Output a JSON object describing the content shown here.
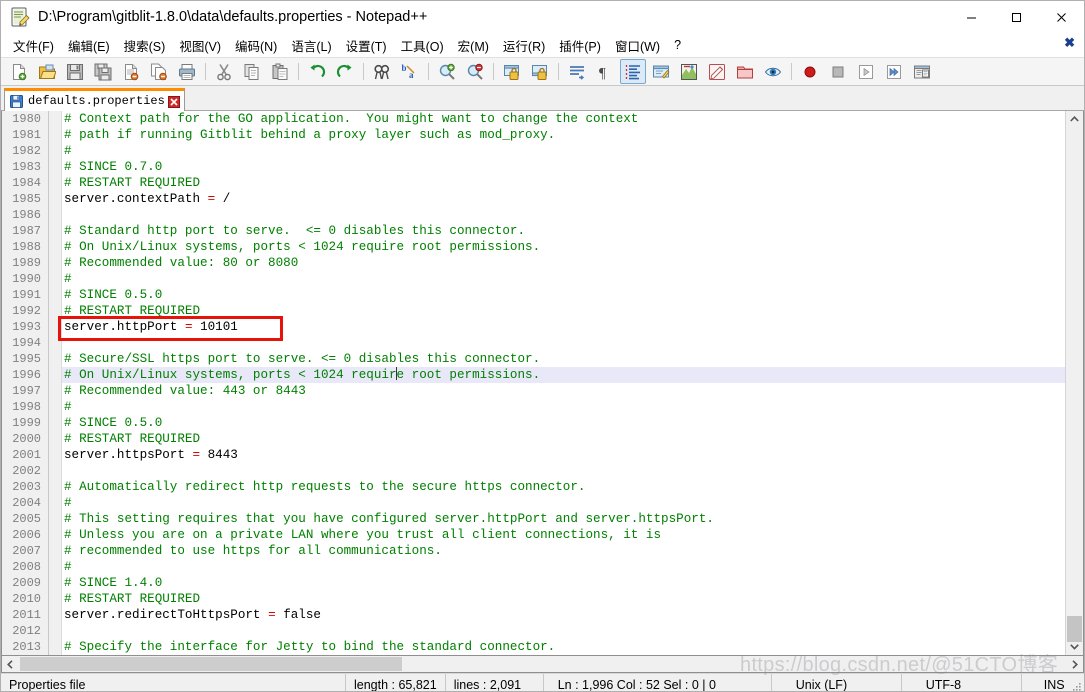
{
  "window": {
    "title": "D:\\Program\\gitblit-1.8.0\\data\\defaults.properties - Notepad++",
    "icon": "notepad-plus-plus-icon",
    "minimize": "—",
    "maximize": "☐",
    "close": "✕"
  },
  "menubar": {
    "items": [
      {
        "label": "文件(F)",
        "name": "menu-file"
      },
      {
        "label": "编辑(E)",
        "name": "menu-edit"
      },
      {
        "label": "搜索(S)",
        "name": "menu-search"
      },
      {
        "label": "视图(V)",
        "name": "menu-view"
      },
      {
        "label": "编码(N)",
        "name": "menu-encoding"
      },
      {
        "label": "语言(L)",
        "name": "menu-language"
      },
      {
        "label": "设置(T)",
        "name": "menu-settings"
      },
      {
        "label": "工具(O)",
        "name": "menu-tools"
      },
      {
        "label": "宏(M)",
        "name": "menu-macro"
      },
      {
        "label": "运行(R)",
        "name": "menu-run"
      },
      {
        "label": "插件(P)",
        "name": "menu-plugins"
      },
      {
        "label": "窗口(W)",
        "name": "menu-window"
      },
      {
        "label": "?",
        "name": "menu-help"
      }
    ],
    "close_doc": "✖"
  },
  "toolbar": {
    "buttons": [
      {
        "name": "new-file-icon",
        "title": "New"
      },
      {
        "name": "open-file-icon",
        "title": "Open"
      },
      {
        "name": "save-icon",
        "title": "Save"
      },
      {
        "name": "save-all-icon",
        "title": "Save All"
      },
      {
        "name": "close-file-icon",
        "title": "Close"
      },
      {
        "name": "close-all-icon",
        "title": "Close All"
      },
      {
        "name": "print-icon",
        "title": "Print"
      },
      {
        "name": "separator"
      },
      {
        "name": "cut-icon",
        "title": "Cut"
      },
      {
        "name": "copy-icon",
        "title": "Copy"
      },
      {
        "name": "paste-icon",
        "title": "Paste"
      },
      {
        "name": "separator"
      },
      {
        "name": "undo-icon",
        "title": "Undo"
      },
      {
        "name": "redo-icon",
        "title": "Redo"
      },
      {
        "name": "separator"
      },
      {
        "name": "find-icon",
        "title": "Find"
      },
      {
        "name": "replace-icon",
        "title": "Replace"
      },
      {
        "name": "separator"
      },
      {
        "name": "zoom-in-icon",
        "title": "Zoom In"
      },
      {
        "name": "zoom-out-icon",
        "title": "Zoom Out"
      },
      {
        "name": "separator"
      },
      {
        "name": "sync-vertical-scroll-icon",
        "title": "Synchronize Vertical Scrolling"
      },
      {
        "name": "sync-horizontal-scroll-icon",
        "title": "Synchronize Horizontal Scrolling"
      },
      {
        "name": "separator"
      },
      {
        "name": "word-wrap-icon",
        "title": "Word Wrap"
      },
      {
        "name": "show-all-characters-icon",
        "title": "Show All Characters"
      },
      {
        "name": "show-indent-guide-icon",
        "title": "Show Indent Guide",
        "active": true
      },
      {
        "name": "user-defined-dialog-icon",
        "title": "User Defined Dialogue"
      },
      {
        "name": "document-map-icon",
        "title": "Document Map"
      },
      {
        "name": "function-list-icon",
        "title": "Function List"
      },
      {
        "name": "folder-as-workspace-icon",
        "title": "Folder as Workspace"
      },
      {
        "name": "monitoring-icon",
        "title": "Monitoring"
      },
      {
        "name": "separator"
      },
      {
        "name": "record-macro-icon",
        "title": "Start Recording"
      },
      {
        "name": "stop-macro-icon",
        "title": "Stop Recording"
      },
      {
        "name": "play-macro-icon",
        "title": "Playback"
      },
      {
        "name": "run-macro-multiple-icon",
        "title": "Run a Macro Multiple Times"
      },
      {
        "name": "save-macro-icon",
        "title": "Save Current Recorded Macro"
      }
    ]
  },
  "tabs": [
    {
      "label": "defaults.properties",
      "icon": "saved-disk-icon",
      "close": "✖",
      "active": true
    }
  ],
  "editor": {
    "first_line": 1980,
    "current_line": 1996,
    "caret_col_char": 44,
    "highlight_box": {
      "line": 1993,
      "label": "server.httpPort = 10101"
    },
    "lines": [
      {
        "n": 1980,
        "type": "comment",
        "text": "# Context path for the GO application.  You might want to change the context"
      },
      {
        "n": 1981,
        "type": "comment",
        "text": "# path if running Gitblit behind a proxy layer such as mod_proxy."
      },
      {
        "n": 1982,
        "type": "comment",
        "text": "#"
      },
      {
        "n": 1983,
        "type": "comment",
        "text": "# SINCE 0.7.0"
      },
      {
        "n": 1984,
        "type": "comment",
        "text": "# RESTART REQUIRED"
      },
      {
        "n": 1985,
        "type": "prop",
        "key": "server.contextPath",
        "eq": "=",
        "value": "/"
      },
      {
        "n": 1986,
        "type": "blank",
        "text": ""
      },
      {
        "n": 1987,
        "type": "comment",
        "text": "# Standard http port to serve.  <= 0 disables this connector."
      },
      {
        "n": 1988,
        "type": "comment",
        "text": "# On Unix/Linux systems, ports < 1024 require root permissions."
      },
      {
        "n": 1989,
        "type": "comment",
        "text": "# Recommended value: 80 or 8080"
      },
      {
        "n": 1990,
        "type": "comment",
        "text": "#"
      },
      {
        "n": 1991,
        "type": "comment",
        "text": "# SINCE 0.5.0"
      },
      {
        "n": 1992,
        "type": "comment",
        "text": "# RESTART REQUIRED"
      },
      {
        "n": 1993,
        "type": "prop",
        "key": "server.httpPort",
        "eq": "=",
        "value": "10101"
      },
      {
        "n": 1994,
        "type": "blank",
        "text": ""
      },
      {
        "n": 1995,
        "type": "comment",
        "text": "# Secure/SSL https port to serve. <= 0 disables this connector."
      },
      {
        "n": 1996,
        "type": "comment",
        "text": "# On Unix/Linux systems, ports < 1024 require root permissions.",
        "caret_after": 44
      },
      {
        "n": 1997,
        "type": "comment",
        "text": "# Recommended value: 443 or 8443"
      },
      {
        "n": 1998,
        "type": "comment",
        "text": "#"
      },
      {
        "n": 1999,
        "type": "comment",
        "text": "# SINCE 0.5.0"
      },
      {
        "n": 2000,
        "type": "comment",
        "text": "# RESTART REQUIRED"
      },
      {
        "n": 2001,
        "type": "prop",
        "key": "server.httpsPort",
        "eq": "=",
        "value": "8443"
      },
      {
        "n": 2002,
        "type": "blank",
        "text": ""
      },
      {
        "n": 2003,
        "type": "comment",
        "text": "# Automatically redirect http requests to the secure https connector."
      },
      {
        "n": 2004,
        "type": "comment",
        "text": "#"
      },
      {
        "n": 2005,
        "type": "comment",
        "text": "# This setting requires that you have configured server.httpPort and server.httpsPort."
      },
      {
        "n": 2006,
        "type": "comment",
        "text": "# Unless you are on a private LAN where you trust all client connections, it is"
      },
      {
        "n": 2007,
        "type": "comment",
        "text": "# recommended to use https for all communications."
      },
      {
        "n": 2008,
        "type": "comment",
        "text": "#"
      },
      {
        "n": 2009,
        "type": "comment",
        "text": "# SINCE 1.4.0"
      },
      {
        "n": 2010,
        "type": "comment",
        "text": "# RESTART REQUIRED"
      },
      {
        "n": 2011,
        "type": "prop",
        "key": "server.redirectToHttpsPort",
        "eq": "=",
        "value": "false"
      },
      {
        "n": 2012,
        "type": "blank",
        "text": ""
      },
      {
        "n": 2013,
        "type": "comment",
        "text": "# Specify the interface for Jetty to bind the standard connector."
      }
    ]
  },
  "scrollbars": {
    "vertical": {
      "up": "⌃",
      "down": "⌄"
    },
    "horizontal": {
      "left": "‹",
      "right": "›"
    }
  },
  "statusbar": {
    "file_type": "Properties file",
    "length": "length : 65,821",
    "lines": "lines : 2,091",
    "position": "Ln : 1,996     Col : 52     Sel : 0 | 0",
    "eol": "Unix (LF)",
    "encoding": "UTF-8",
    "mode": "INS"
  },
  "watermark": "https://blog.csdn.net/@51CTO博客",
  "colors": {
    "comment": "#008000",
    "equals": "#e00000",
    "tab_active_border": "#ff8c00",
    "annotation_box": "#e8120b",
    "current_line_bg": "#e8e8f8"
  }
}
